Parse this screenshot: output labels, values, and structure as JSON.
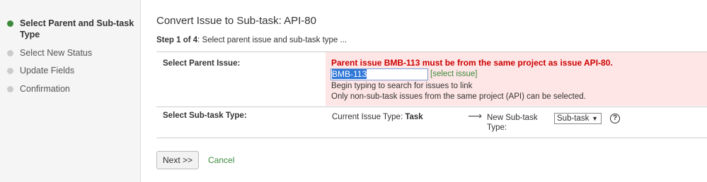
{
  "sidebar": {
    "steps": [
      {
        "label": "Select Parent and Sub-task Type"
      },
      {
        "label": "Select New Status"
      },
      {
        "label": "Update Fields"
      },
      {
        "label": "Confirmation"
      }
    ]
  },
  "main": {
    "title": "Convert Issue to Sub-task: API-80",
    "step_prefix": "Step 1 of 4",
    "step_text": ": Select parent issue and sub-task type ..."
  },
  "parent_issue": {
    "label": "Select Parent Issue:",
    "error": "Parent issue BMB-113 must be from the same project as issue API-80.",
    "input_value": "BMB-113",
    "select_link": "[select issue]",
    "help_line1": "Begin typing to search for issues to link",
    "help_line2": "Only non-sub-task issues from the same project (API) can be selected."
  },
  "subtask_type": {
    "label": "Select Sub-task Type:",
    "current_prefix": "Current Issue Type: ",
    "current_value": "Task",
    "arrow": "⟶",
    "new_label": "New Sub-task Type:",
    "selected": "Sub-task",
    "help_icon": "?"
  },
  "actions": {
    "next": "Next >>",
    "cancel": "Cancel"
  },
  "colors": {
    "error": "#cc0000",
    "error_bg": "#ffe6e6",
    "link": "#3c8a3c",
    "active_dot": "#3c8a3c"
  }
}
